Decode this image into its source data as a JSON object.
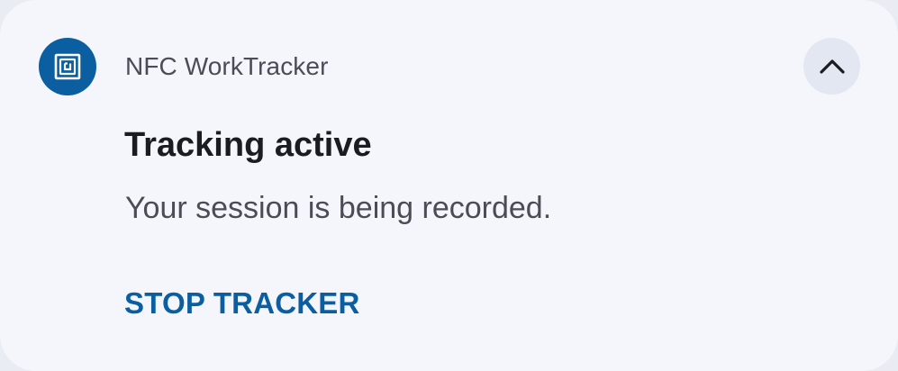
{
  "notification": {
    "app_name": "NFC WorkTracker",
    "app_icon": "nfc-tag-icon",
    "collapse_icon": "chevron-up-icon",
    "title": "Tracking active",
    "body": "Your session is being recorded.",
    "action_label": "STOP TRACKER"
  },
  "colors": {
    "card_background": "#f4f6fc",
    "icon_background": "#0b5fa0",
    "action_text": "#0b5fa0",
    "title_text": "#1a1c21",
    "secondary_text": "#4a4d55",
    "collapse_button_background": "#e3e7f2"
  }
}
